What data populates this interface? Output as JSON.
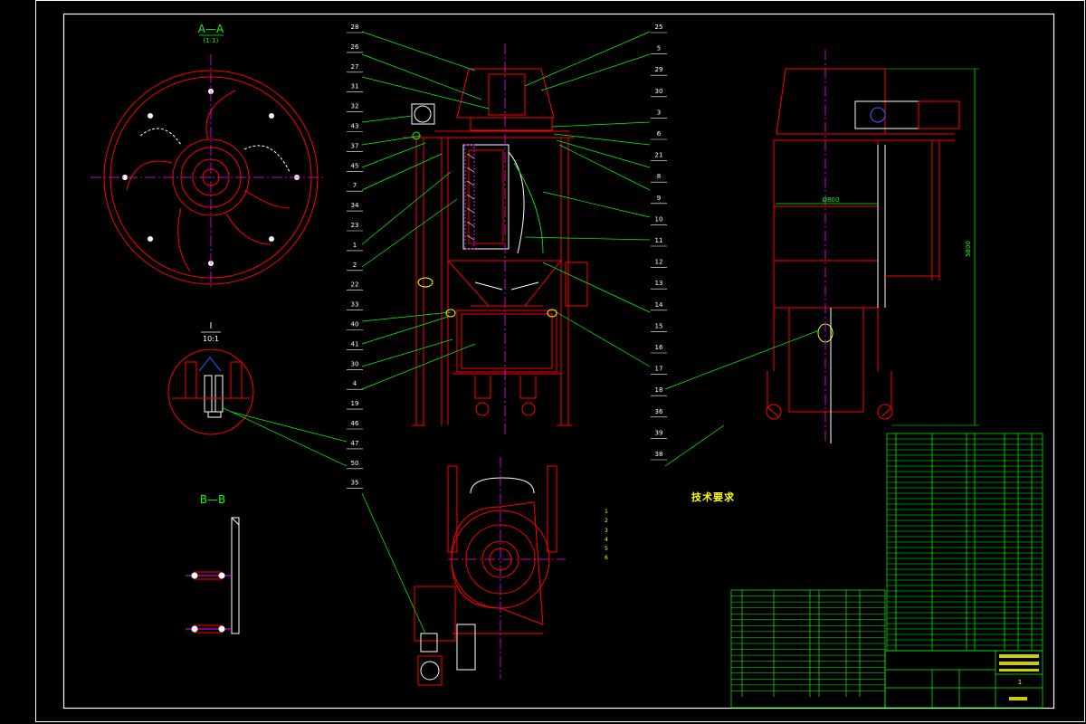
{
  "section_aa": {
    "title": "A—A",
    "scale": "(1:1)"
  },
  "detail_i": {
    "title": "I",
    "scale": "10:1"
  },
  "section_bb": {
    "title": "B—B"
  },
  "dimensions": {
    "diameter": "Ø800",
    "height": "5800"
  },
  "tech_requirements": {
    "title": "技术要求",
    "lines": [
      "1 ",
      "2 ",
      "3 ",
      "4 ",
      "5 ",
      "",
      "6 "
    ]
  },
  "left_callouts": [
    "28",
    "26",
    "27",
    "31",
    "32",
    "43",
    "37",
    "45",
    "7",
    "34",
    "23",
    "1",
    "2",
    "22",
    "33",
    "40",
    "41",
    "30",
    "4",
    "19",
    "46",
    "47",
    "50",
    "35"
  ],
  "right_callouts": [
    "25",
    "5",
    "29",
    "30",
    "3",
    "6",
    "21",
    "8",
    "9",
    "10",
    "11",
    "12",
    "13",
    "14",
    "15",
    "16",
    "17",
    "18",
    "36",
    "39",
    "38"
  ],
  "title_block": {
    "sheet_no": "1"
  },
  "colors": {
    "outline": "#ffffff",
    "drawing": "#ff0000",
    "leader": "#00ff00",
    "table": "#00ff00",
    "text": "#ffff00",
    "center": "#ff00ff",
    "hatch": "#ffffff"
  }
}
